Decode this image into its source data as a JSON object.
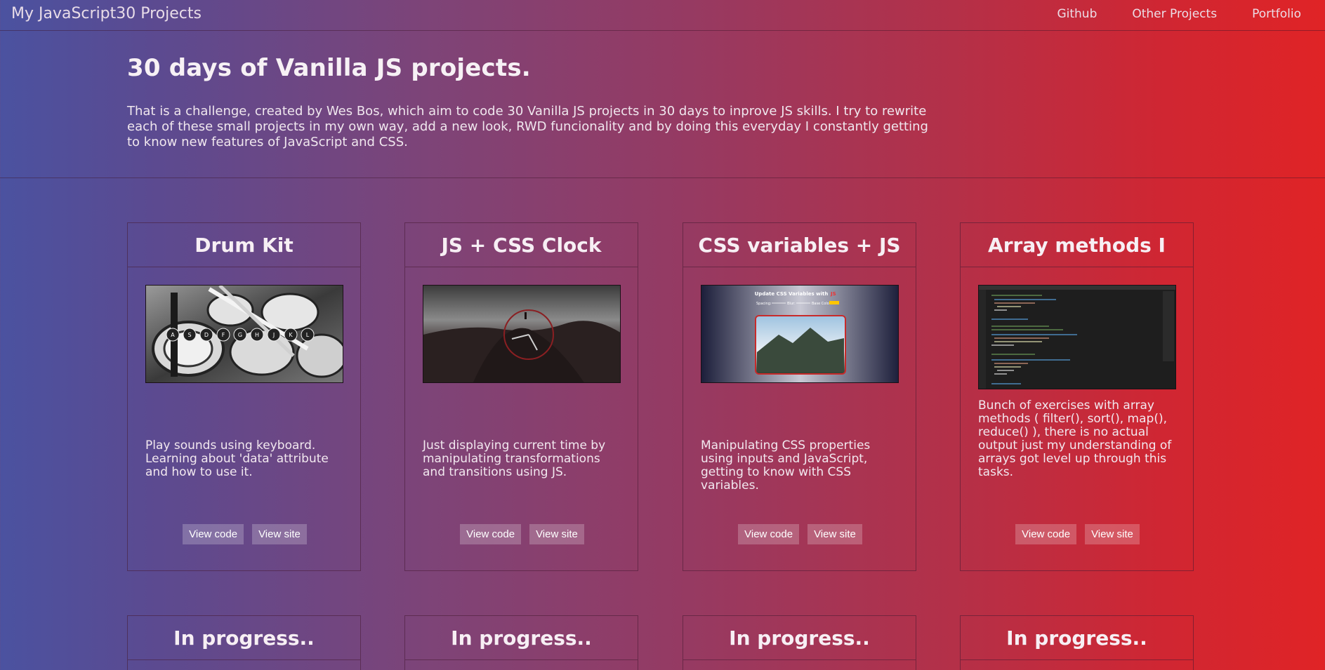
{
  "header": {
    "brand": "My JavaScript30 Projects",
    "nav": [
      "Github",
      "Other Projects",
      "Portfolio"
    ]
  },
  "intro": {
    "title": "30 days of Vanilla JS projects.",
    "text": "That is a challenge, created by Wes Bos, which aim to code 30 Vanilla JS projects in 30 days to inprove JS skills. I try to rewrite each of these small projects in my own way, add a new look, RWD funcionality and by doing this everyday I constantly getting to know new features of JavaScript and CSS."
  },
  "cards": [
    {
      "title": "Drum Kit",
      "desc": "Play sounds using keyboard. Learning about 'data' attribute and how to use it.",
      "view_code": "View code",
      "view_site": "View site",
      "thumb_keys": [
        "A",
        "S",
        "D",
        "F",
        "G",
        "H",
        "J",
        "K",
        "L"
      ]
    },
    {
      "title": "JS + CSS Clock",
      "desc": "Just displaying current time by manipulating transformations and transitions using JS.",
      "view_code": "View code",
      "view_site": "View site"
    },
    {
      "title": "CSS variables + JS",
      "desc": "Manipulating CSS properties using inputs and JavaScript, getting to know with CSS variables.",
      "view_code": "View code",
      "view_site": "View site",
      "thumb_title": "Update CSS Variables with",
      "thumb_title_accent": "JS",
      "thumb_controls": [
        "Spacing:",
        "Blur:",
        "Base Color"
      ]
    },
    {
      "title": "Array methods I",
      "desc": "Bunch of exercises with array methods ( filter(), sort(), map(), reduce() ), there is no actual output just my understanding of arrays got level up through this tasks.",
      "view_code": "View code",
      "view_site": "View site"
    }
  ],
  "progress_cards": [
    "In progress..",
    "In progress..",
    "In progress..",
    "In progress.."
  ],
  "colors": {
    "gradient_left": "#4b52a0",
    "gradient_right": "#e02426"
  }
}
